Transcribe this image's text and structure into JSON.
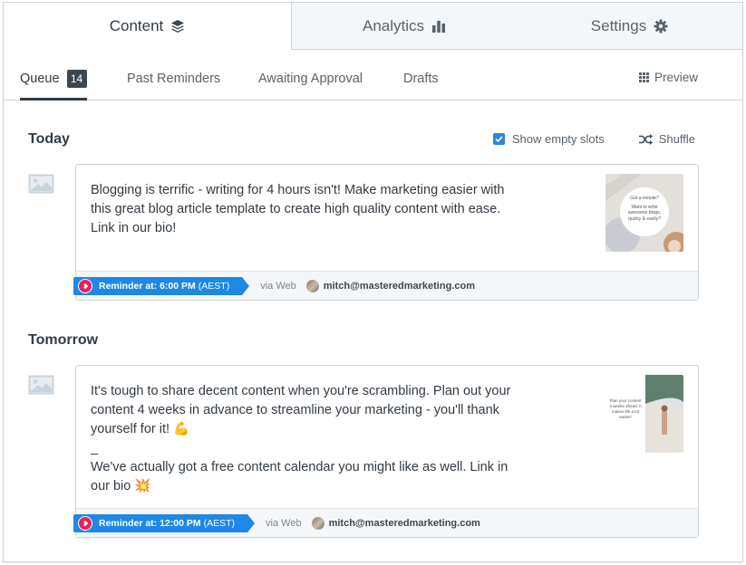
{
  "top_tabs": [
    {
      "label": "Content",
      "icon": "layers-icon",
      "active": true
    },
    {
      "label": "Analytics",
      "icon": "bar-chart-icon",
      "active": false
    },
    {
      "label": "Settings",
      "icon": "gear-icon",
      "active": false
    }
  ],
  "sub_tabs": {
    "queue_label": "Queue",
    "queue_count": "14",
    "past_reminders": "Past Reminders",
    "awaiting_approval": "Awaiting Approval",
    "drafts": "Drafts",
    "preview": "Preview"
  },
  "controls": {
    "show_empty_slots": "Show empty slots",
    "show_empty_slots_checked": true,
    "shuffle": "Shuffle"
  },
  "days": [
    {
      "heading": "Today",
      "post": {
        "text": "Blogging is terrific - writing for 4 hours isn't! Make marketing easier with\nthis great blog article template to create high quality content with ease.\nLink in our bio!",
        "reminder_label": "Reminder at: 6:00 PM",
        "timezone": "(AEST)",
        "via": "via Web",
        "user_email": "mitch@masteredmarketing.com",
        "thumb_heading": "Got a minute?",
        "thumb_text": "Want to write awesome blogs, quicky & easily?"
      }
    },
    {
      "heading": "Tomorrow",
      "post": {
        "text": "It's tough to share decent content when you're scrambling. Plan out your\ncontent 4 weeks in advance to streamline your marketing - you'll thank\nyourself for it! 💪\n_\nWe've actually got a free content calendar you might like as well. Link in\nour bio 💥",
        "reminder_label": "Reminder at: 12:00 PM",
        "timezone": "(AEST)",
        "via": "via Web",
        "user_email": "mitch@masteredmarketing.com",
        "thumb_text": "Plan your content 4 weeks ahead. It makes life a lot easier!"
      }
    }
  ],
  "colors": {
    "accent": "#1e88e5",
    "checkbox": "#2c87d6",
    "reminder_icon": "#e0245e",
    "text": "#323b43"
  }
}
